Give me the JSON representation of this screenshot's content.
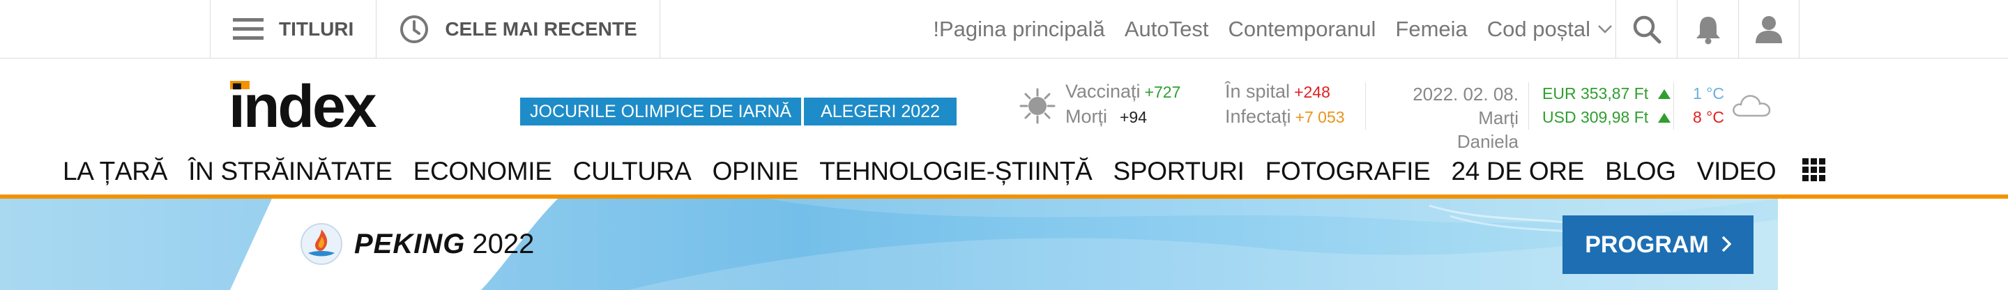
{
  "topbar": {
    "titles_label": "TITLURI",
    "recent_label": "CELE MAI RECENTE",
    "links": [
      "!Pagina principală",
      "AutoTest",
      "Contemporanul",
      "Femeia"
    ],
    "postcode_label": "Cod poștal"
  },
  "header": {
    "logo_text": "index",
    "chips": [
      "JOCURILE OLIMPICE DE IARNĂ",
      "ALEGERI 2022"
    ]
  },
  "covid": {
    "vaccinated_label": "Vaccinați",
    "vaccinated_value": "+727",
    "deaths_label": "Morți",
    "deaths_value": "+94",
    "hospital_label": "În spital",
    "hospital_value": "+248",
    "infected_label": "Infectați",
    "infected_value": "+7 053"
  },
  "date": {
    "line1": "2022. 02. 08. Marți",
    "line2": "Daniela"
  },
  "currency": {
    "eur": "EUR 353,87 Ft",
    "usd": "USD 309,98 Ft"
  },
  "weather": {
    "min": "1 °C",
    "max": "8 °C"
  },
  "nav": [
    "LA ȚARĂ",
    "ÎN STRĂINĂTATE",
    "ECONOMIE",
    "CULTURA",
    "OPINIE",
    "TEHNOLOGIE-ȘTIINȚĂ",
    "SPORTURI",
    "FOTOGRAFIE",
    "24 DE ORE",
    "BLOG",
    "VIDEO"
  ],
  "banner": {
    "city": "PEKING",
    "year": "2022",
    "button_label": "PROGRAM"
  },
  "colors": {
    "accent_orange": "#f39200",
    "chip_blue": "#1e8cc8",
    "program_blue": "#1d6eb3"
  }
}
